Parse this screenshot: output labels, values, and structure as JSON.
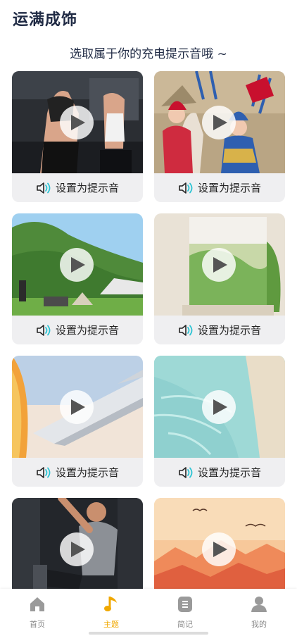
{
  "header": {
    "title": "运满成饰"
  },
  "subtitle": "选取属于你的充电提示音哦 ~",
  "cards": [
    {
      "scene": "treadmill-gym",
      "action_label": "设置为提示音"
    },
    {
      "scene": "opera-performers",
      "action_label": "设置为提示音"
    },
    {
      "scene": "mountain-camping",
      "action_label": "设置为提示音"
    },
    {
      "scene": "window-greenery",
      "action_label": "设置为提示音"
    },
    {
      "scene": "airplane-wing-sunset",
      "action_label": "设置为提示音"
    },
    {
      "scene": "sea-waves",
      "action_label": "设置为提示音"
    },
    {
      "scene": "gym-workout",
      "action_label": "设置为提示音"
    },
    {
      "scene": "orange-mountains-birds",
      "action_label": "设置为提示音"
    }
  ],
  "tabbar": {
    "items": [
      {
        "label": "首页",
        "icon": "home-icon"
      },
      {
        "label": "主题",
        "icon": "music-note-icon"
      },
      {
        "label": "简记",
        "icon": "notes-icon"
      },
      {
        "label": "我的",
        "icon": "user-icon"
      }
    ],
    "active_index": 1,
    "active_color": "#f0a800",
    "inactive_color": "#8a8a8a"
  },
  "colors": {
    "title": "#1f2a44",
    "card_bg": "#efeff1",
    "speaker_accent": "#2cc4d4"
  }
}
